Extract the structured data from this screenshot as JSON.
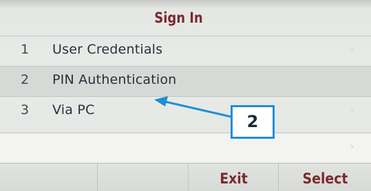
{
  "header": {
    "title": "Sign In"
  },
  "menu": {
    "items": [
      {
        "num": "1",
        "label": "User Credentials"
      },
      {
        "num": "2",
        "label": "PIN Authentication",
        "selected": true
      },
      {
        "num": "3",
        "label": "Via PC"
      }
    ]
  },
  "softkeys": {
    "exit_label": "Exit",
    "select_label": "Select"
  },
  "annotation": {
    "callout_label": "2"
  },
  "icons": {
    "row_chevron": "chevron-right-icon"
  },
  "colors": {
    "title_text": "#7a2a2e",
    "annotation_blue": "#1e8fd6",
    "selected_row": "#d7d9d6"
  }
}
